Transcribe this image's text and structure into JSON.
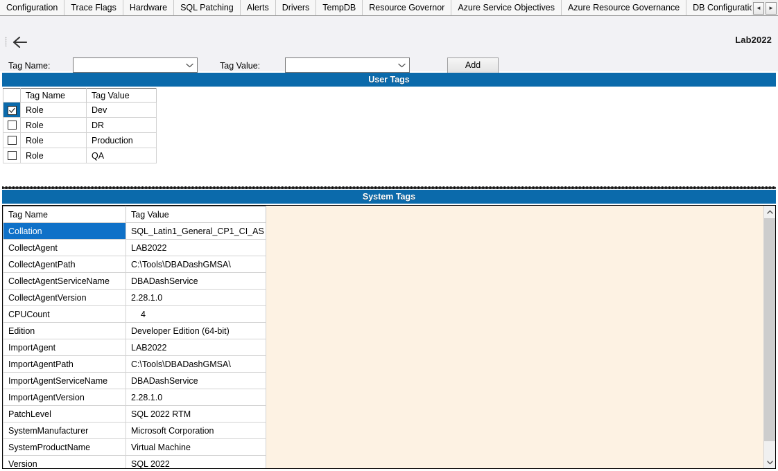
{
  "tabs": [
    {
      "label": "Configuration"
    },
    {
      "label": "Trace Flags"
    },
    {
      "label": "Hardware"
    },
    {
      "label": "SQL Patching"
    },
    {
      "label": "Alerts"
    },
    {
      "label": "Drivers"
    },
    {
      "label": "TempDB"
    },
    {
      "label": "Resource Governor"
    },
    {
      "label": "Azure Service Objectives"
    },
    {
      "label": "Azure Resource Governance"
    },
    {
      "label": "DB Configuratio"
    }
  ],
  "tab_scroll": {
    "left_label": "◄",
    "right_label": "►",
    "left_icon": "scroll-left-icon",
    "right_icon": "scroll-right-icon"
  },
  "toolbar": {
    "back_icon": "back-arrow-icon",
    "grip_icon": "drag-grip-icon",
    "title": "Lab2022",
    "tag_name_label": "Tag Name:",
    "tag_name_value": "",
    "tag_name_placeholder": "",
    "tag_value_label": "Tag Value:",
    "tag_value_value": "",
    "tag_value_placeholder": "",
    "add_label": "Add",
    "chevron_icon": "chevron-down-icon"
  },
  "user_tags": {
    "section_title": "User Tags",
    "columns": [
      "",
      "Tag Name",
      "Tag Value"
    ],
    "rows": [
      {
        "checked": true,
        "name": "Role",
        "value": "Dev"
      },
      {
        "checked": false,
        "name": "Role",
        "value": "DR"
      },
      {
        "checked": false,
        "name": "Role",
        "value": "Production"
      },
      {
        "checked": false,
        "name": "Role",
        "value": "QA"
      }
    ]
  },
  "system_tags": {
    "section_title": "System Tags",
    "columns": [
      "Tag Name",
      "Tag Value"
    ],
    "rows": [
      {
        "name": "Collation",
        "value": "SQL_Latin1_General_CP1_CI_AS",
        "selected": true
      },
      {
        "name": "CollectAgent",
        "value": "LAB2022",
        "selected": false
      },
      {
        "name": "CollectAgentPath",
        "value": "C:\\Tools\\DBADashGMSA\\",
        "selected": false
      },
      {
        "name": "CollectAgentServiceName",
        "value": "DBADashService",
        "selected": false
      },
      {
        "name": "CollectAgentVersion",
        "value": "2.28.1.0",
        "selected": false
      },
      {
        "name": "CPUCount",
        "value": "4",
        "selected": false,
        "numeric": true
      },
      {
        "name": "Edition",
        "value": "Developer Edition (64-bit)",
        "selected": false
      },
      {
        "name": "ImportAgent",
        "value": "LAB2022",
        "selected": false
      },
      {
        "name": "ImportAgentPath",
        "value": "C:\\Tools\\DBADashGMSA\\",
        "selected": false
      },
      {
        "name": "ImportAgentServiceName",
        "value": "DBADashService",
        "selected": false
      },
      {
        "name": "ImportAgentVersion",
        "value": "2.28.1.0",
        "selected": false
      },
      {
        "name": "PatchLevel",
        "value": "SQL 2022 RTM",
        "selected": false
      },
      {
        "name": "SystemManufacturer",
        "value": "Microsoft Corporation",
        "selected": false
      },
      {
        "name": "SystemProductName",
        "value": "Virtual Machine",
        "selected": false
      },
      {
        "name": "Version",
        "value": "SQL 2022",
        "selected": false
      }
    ],
    "scrollbar": {
      "up_icon": "scroll-up-icon",
      "down_icon": "scroll-down-icon",
      "up_label": "∧",
      "down_label": "∨"
    }
  },
  "colors": {
    "section_header_bg": "#0b6aab",
    "selection_blue": "#0f71c8",
    "content_bg": "#fdf2e3",
    "toolbar_bg": "#f2f2f5"
  }
}
